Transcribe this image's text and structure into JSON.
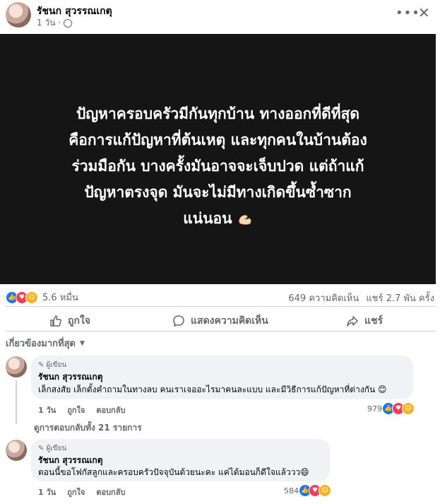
{
  "post": {
    "author": "รัชนก สุวรรณเกตุ",
    "time": "1 วัน ·",
    "more_icon": "ellipsis-icon",
    "close_icon": "close-icon",
    "text_lines": [
      "ปัญหาครอบครัวมีกันทุกบ้าน ทางออกที่ดีที่สุด",
      "คือการแก้ปัญหาที่ต้นเหตุ และทุกคนในบ้านต้อง",
      "ร่วมมือกัน บางครั้งมันอาจจะเจ็บปวด แต่ถ้าแก้",
      "ปัญหาตรงจุด มันจะไม่มีทางเกิดขึ้นซ้ำซาก",
      "แน่นอน"
    ]
  },
  "stats": {
    "reactions_count": "5.6 หมื่น",
    "comments": "649 ความคิดเห็น",
    "shares": "แชร์ 2.7 พัน ครั้ง"
  },
  "actions": {
    "like": "ถูกใจ",
    "comment": "แสดงความคิดเห็น",
    "share": "แชร์"
  },
  "sort": {
    "label": "เกี่ยวข้องมากที่สุด"
  },
  "comments": [
    {
      "tag": "ผู้เขียน",
      "name": "รัชนก สุวรรณเกตุ",
      "text": "เล็กสงสัย เล็กตั้งคำถามในทางลบ คนเราเจออะไรมาคนละแบบ และมีวิธีการแก้ปัญหาที่ต่างกัน 😊",
      "time": "1 วัน",
      "like": "ถูกใจ",
      "reply": "ตอบกลับ",
      "count": "979"
    },
    {
      "tag": "ผู้เขียน",
      "name": "รัชนก สุวรรณเกตุ",
      "text": "ตอนนี้ขอโฟกัสลูกและครอบครัวปัจจุบันด้วยนะคะ แค่ได้มอนก็ดีใจแล้ววว😄",
      "time": "1 วัน",
      "like": "ถูกใจ",
      "reply": "ตอบกลับ",
      "count": "584"
    }
  ],
  "view_replies": "ดูการตอบกลับทั้ง 21 รายการ",
  "colors": {
    "accent": "#1877f2",
    "image_bg": "#151515",
    "bubble": "#f0f2f5"
  }
}
